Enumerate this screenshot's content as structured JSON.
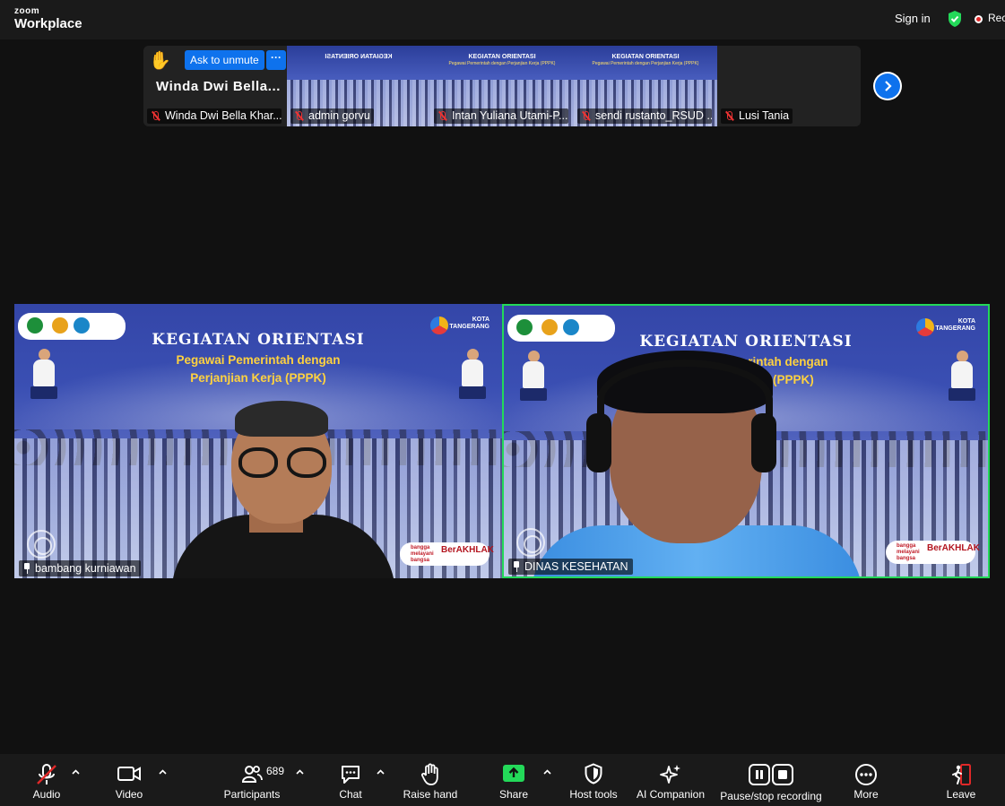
{
  "app": {
    "logo_line1": "zoom",
    "logo_line2": "Workplace"
  },
  "header": {
    "sign_in": "Sign in",
    "rec_label": "Rec"
  },
  "strip": {
    "ask_to_unmute": "Ask to unmute",
    "more_dots": "···",
    "featured_name": "Winda Dwi Bella...",
    "tiles": [
      {
        "name": "Winda Dwi Bella Khar..."
      },
      {
        "name": "admin gorvu"
      },
      {
        "name": "Intan Yuliana Utami-P..."
      },
      {
        "name": "sendi rustanto_RSUD ..."
      },
      {
        "name": "Lusi Tania"
      }
    ],
    "mini_title": "KEGIATAN ORIENTASI",
    "mini_sub": "Pegawai Pemerintah dengan Perjanjian Kerja (PPPK)"
  },
  "slide": {
    "title": "KEGIATAN ORIENTASI",
    "subtitle_line1": "Pegawai Pemerintah dengan",
    "subtitle_line2": "Perjanjian Kerja (PPPK)",
    "kota_line1": "KOTA",
    "kota_line2": "TANGERANG",
    "badge_small": "bangga melayani bangsa",
    "badge_big": "BerAKHLAK"
  },
  "videos": [
    {
      "name": "bambang kurniawan",
      "active": false
    },
    {
      "name": "DINAS KESEHATAN",
      "active": true
    }
  ],
  "toolbar": {
    "audio": "Audio",
    "video": "Video",
    "participants": "Participants",
    "participants_count": "689",
    "chat": "Chat",
    "raise_hand": "Raise hand",
    "share": "Share",
    "host_tools": "Host tools",
    "ai_companion": "AI Companion",
    "recording": "Pause/stop recording",
    "more": "More",
    "leave": "Leave"
  },
  "colors": {
    "accent": "#0e72ed",
    "active_speaker": "#23d959",
    "share_green": "#23d959",
    "leave_red": "#e02828"
  }
}
